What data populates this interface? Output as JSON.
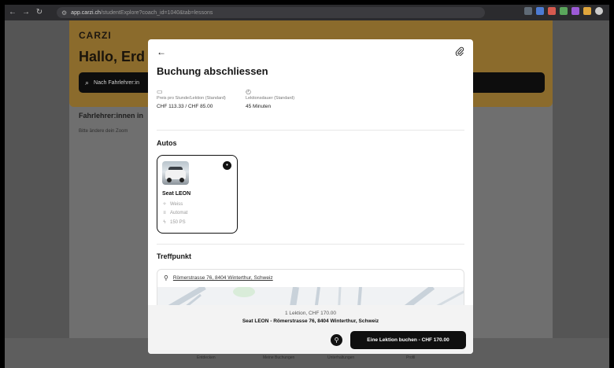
{
  "browser": {
    "url_host": "app.carzi.ch",
    "url_path": "/studentExplore?coach_id=1040&tab=lessons"
  },
  "page": {
    "logo": "CARZI",
    "greeting": "Hallo, Erd",
    "search_placeholder": "Nach Fahrlehrer:in",
    "teachers_title": "Fahrlehrer:innen in",
    "teachers_note": "Bitte ändere dein Zoom",
    "nav": [
      "Entdecken",
      "Meine Buchungen",
      "Unterhaltungen",
      "Profil"
    ]
  },
  "modal": {
    "title": "Buchung abschliessen",
    "price_label": "Preis pro Stunde/Lektion (Standard)",
    "price_value": "CHF 113.33 / CHF 85.00",
    "duration_label": "Lektionsdauer (Standard)",
    "duration_value": "45 Minuten",
    "cars_title": "Autos",
    "car": {
      "name": "Seat LEON",
      "color": "Weiss",
      "transmission": "Automat",
      "power": "150 PS"
    },
    "meeting_title": "Treffpunkt",
    "meeting_address": "Römerstrasse 76, 8404 Winterthur, Schweiz",
    "summary_line1": "1 Lektion, CHF 170.00",
    "summary_line2": "Seat LEON - Römerstrasse 76, 8404 Winterthur, Schweiz",
    "book_button": "Eine Lektion buchen - CHF 170.00"
  },
  "colors": {
    "banner": "#8b6b2c",
    "modal_bg": "#ffffff",
    "primary_button": "#0f0f0f"
  },
  "icons": {
    "back": "arrow-left-icon",
    "attach": "paperclip-icon",
    "price": "money-icon",
    "duration": "clock-icon",
    "pin": "map-pin-icon"
  }
}
